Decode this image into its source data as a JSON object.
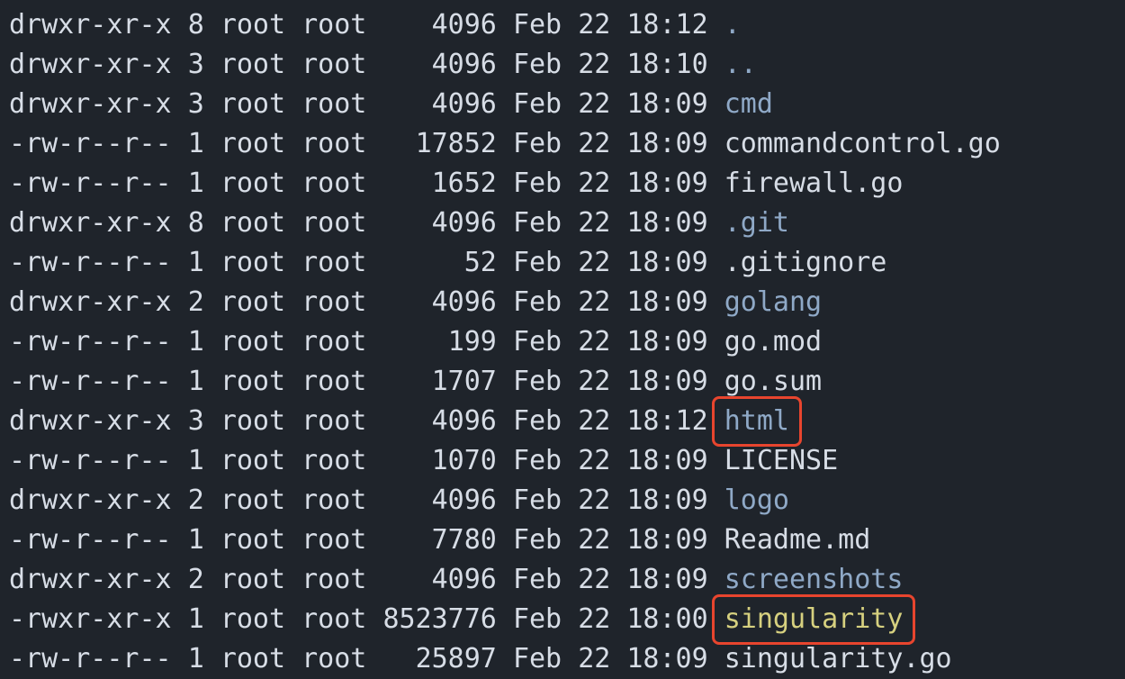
{
  "listing": {
    "rows": [
      {
        "perms": "drwxr-xr-x",
        "links": "8",
        "owner": "root",
        "group": "root",
        "size": "4096",
        "month": "Feb",
        "day": "22",
        "time": "18:12",
        "name": "."
      },
      {
        "perms": "drwxr-xr-x",
        "links": "3",
        "owner": "root",
        "group": "root",
        "size": "4096",
        "month": "Feb",
        "day": "22",
        "time": "18:10",
        "name": ".."
      },
      {
        "perms": "drwxr-xr-x",
        "links": "3",
        "owner": "root",
        "group": "root",
        "size": "4096",
        "month": "Feb",
        "day": "22",
        "time": "18:09",
        "name": "cmd"
      },
      {
        "perms": "-rw-r--r--",
        "links": "1",
        "owner": "root",
        "group": "root",
        "size": "17852",
        "month": "Feb",
        "day": "22",
        "time": "18:09",
        "name": "commandcontrol.go"
      },
      {
        "perms": "-rw-r--r--",
        "links": "1",
        "owner": "root",
        "group": "root",
        "size": "1652",
        "month": "Feb",
        "day": "22",
        "time": "18:09",
        "name": "firewall.go"
      },
      {
        "perms": "drwxr-xr-x",
        "links": "8",
        "owner": "root",
        "group": "root",
        "size": "4096",
        "month": "Feb",
        "day": "22",
        "time": "18:09",
        "name": ".git"
      },
      {
        "perms": "-rw-r--r--",
        "links": "1",
        "owner": "root",
        "group": "root",
        "size": "52",
        "month": "Feb",
        "day": "22",
        "time": "18:09",
        "name": ".gitignore"
      },
      {
        "perms": "drwxr-xr-x",
        "links": "2",
        "owner": "root",
        "group": "root",
        "size": "4096",
        "month": "Feb",
        "day": "22",
        "time": "18:09",
        "name": "golang"
      },
      {
        "perms": "-rw-r--r--",
        "links": "1",
        "owner": "root",
        "group": "root",
        "size": "199",
        "month": "Feb",
        "day": "22",
        "time": "18:09",
        "name": "go.mod"
      },
      {
        "perms": "-rw-r--r--",
        "links": "1",
        "owner": "root",
        "group": "root",
        "size": "1707",
        "month": "Feb",
        "day": "22",
        "time": "18:09",
        "name": "go.sum"
      },
      {
        "perms": "drwxr-xr-x",
        "links": "3",
        "owner": "root",
        "group": "root",
        "size": "4096",
        "month": "Feb",
        "day": "22",
        "time": "18:12",
        "name": "html"
      },
      {
        "perms": "-rw-r--r--",
        "links": "1",
        "owner": "root",
        "group": "root",
        "size": "1070",
        "month": "Feb",
        "day": "22",
        "time": "18:09",
        "name": "LICENSE"
      },
      {
        "perms": "drwxr-xr-x",
        "links": "2",
        "owner": "root",
        "group": "root",
        "size": "4096",
        "month": "Feb",
        "day": "22",
        "time": "18:09",
        "name": "logo"
      },
      {
        "perms": "-rw-r--r--",
        "links": "1",
        "owner": "root",
        "group": "root",
        "size": "7780",
        "month": "Feb",
        "day": "22",
        "time": "18:09",
        "name": "Readme.md"
      },
      {
        "perms": "drwxr-xr-x",
        "links": "2",
        "owner": "root",
        "group": "root",
        "size": "4096",
        "month": "Feb",
        "day": "22",
        "time": "18:09",
        "name": "screenshots"
      },
      {
        "perms": "-rwxr-xr-x",
        "links": "1",
        "owner": "root",
        "group": "root",
        "size": "8523776",
        "month": "Feb",
        "day": "22",
        "time": "18:00",
        "name": "singularity"
      },
      {
        "perms": "-rw-r--r--",
        "links": "1",
        "owner": "root",
        "group": "root",
        "size": "25897",
        "month": "Feb",
        "day": "22",
        "time": "18:09",
        "name": "singularity.go"
      }
    ]
  },
  "colors": {
    "background": "#1f242b",
    "text": "#d7dde6",
    "directory": "#8fa9c7",
    "executable": "#d6d07f",
    "highlight_box": "#e8452e"
  },
  "highlighted_names": [
    "html",
    "singularity"
  ]
}
